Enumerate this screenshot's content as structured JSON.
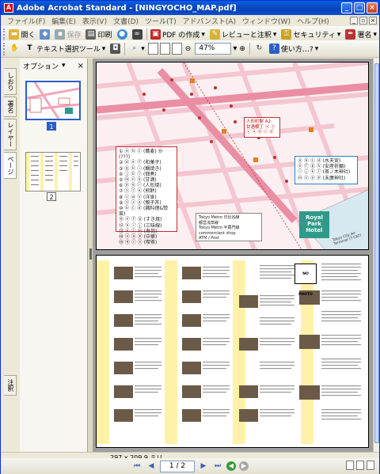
{
  "window": {
    "title": "Adobe Acrobat Standard - [NINGYOCHO_MAP.pdf]",
    "app_icon": "acrobat-icon",
    "min_label": "_",
    "max_label": "□",
    "close_label": "×",
    "mdi_min": "_",
    "mdi_max": "▫",
    "mdi_close": "×"
  },
  "menu": [
    "ファイル(F)",
    "編集(E)",
    "表示(V)",
    "文書(D)",
    "ツール(T)",
    "アドバンスト(A)",
    "ウィンドウ(W)",
    "ヘルプ(H)"
  ],
  "toolbar1": {
    "open": "開く",
    "save": "保存",
    "print": "印刷",
    "create_pdf": "PDF の作成",
    "review": "レビューと注釈",
    "security": "セキュリティ",
    "sign": "署名"
  },
  "toolbar2": {
    "text_select": "テキスト選択ツール",
    "zoom": "47%",
    "how_to": "使い方…?"
  },
  "panel": {
    "options_label": "オプション",
    "close": "×",
    "tabs": [
      "しおり",
      "署名",
      "レイヤー",
      "ページ",
      "注釈"
    ],
    "pages": [
      "1",
      "2"
    ]
  },
  "map": {
    "legend_left": [
      "① ⓐ ⓑ ⓒ (蕎麦) ⑮ (???)",
      "② ⓓ ⓔ ⓕ (和菓子)",
      "③ ⓖ ⓗ ⓘ (鯛焼き)",
      "④ ⓙ ⓚ ⓛ (佃煮)",
      "⑤ ⓜ ⓝ ⓞ (甘酒)",
      "⑥ ⓟ ⓠ ⓡ (人形焼)",
      "⑦ ⓢ ⓣ ⓤ (煎餅)",
      "⑧ ⓥ ⓦ ⓧ (洋食)",
      "⑨ ⓨ ⓩ ⓐ (親子丼)",
      "⑩ ⓑ ⓒ ⓓ (鶏料理&惣菜)",
      "⑪ ⓔ ⓕ ⓖ (すき焼)",
      "⑫ ⓗ ⓘ ⓙ (三味線)",
      "⑬ ⓚ ⓛ ⓜ (寿司)",
      "⑭ ⓝ ⓞ ⓟ (中華)",
      "⑮ ⓠ ⓡ ⓢ (喫茶)",
      "⑯ ⓣ ⓤ ⓥ (玉子焼)",
      "⑰ ⓦ ⓧ ⓨ (パン)"
    ],
    "legend_right": [
      "ⓐ ⓑ ⓒ ⓓ (水天宮)",
      "ⓔ ⓕ ⓖ ⓗ (安産祈願)",
      "ⓘ ⓙ ⓚ ⓛ (茶ノ木神社)",
      "ⓜ ⓝ ⓞ ⓟ (末廣神社)"
    ],
    "note": [
      "人形町駅 A2",
      "甘酒横丁 ⓧ ⓨ",
      "ⓩ ⓐ ⓑ ⓒ ⓓ"
    ],
    "hotel": "Royal Park Hotel",
    "tcat": "Tokyo City Air Terminal (T-CAT)",
    "map_legend": [
      "Tokyo Metro 日比谷線",
      "都営浅草線",
      "Tokyo Metro 半蔵門線",
      "commerciant shop",
      "ATM / Post"
    ]
  },
  "page2": {
    "no_photo": "NO PHOTO"
  },
  "status": {
    "page_size": "297 x 209.9 ミリ",
    "page_field": "1 / 2",
    "first": "⏮",
    "prev": "◀",
    "next": "▶",
    "last": "⏭",
    "back": "◀",
    "forward": "▶"
  },
  "colors": {
    "titlebar": "#0842b6",
    "map_street": "#f3a6b8",
    "map_highlight": "#f7c8d2",
    "accent_red": "#c03030",
    "hotel": "#2e9a8a"
  }
}
